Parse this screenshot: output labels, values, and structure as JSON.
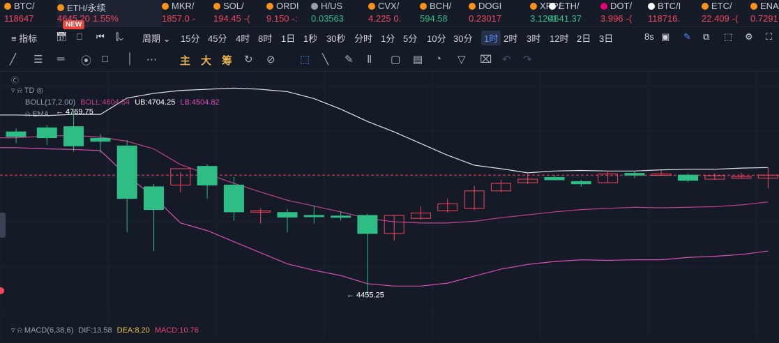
{
  "tickers": [
    {
      "symbol": "BTC/ ",
      "price": "118647",
      "change": "",
      "dir": "dn",
      "coin": "#f7931a"
    },
    {
      "symbol": "ETH/永续",
      "price": "4645.20",
      "change": "1.55%",
      "dir": "dn",
      "coin": "#f7931a",
      "selected": true
    },
    {
      "symbol": "MKR/",
      "price": "1857.0",
      "change": "-",
      "dir": "dn",
      "coin": "#f7931a"
    },
    {
      "symbol": "SOL/",
      "price": "194.45",
      "change": "-(",
      "dir": "dn",
      "coin": "#f7931a"
    },
    {
      "symbol": "ORDI",
      "price": "9.150",
      "change": "-:",
      "dir": "dn",
      "coin": "#f7931a"
    },
    {
      "symbol": "H/US",
      "price": "0.03563",
      "change": "",
      "dir": "up",
      "coin": "#9aa0ab"
    },
    {
      "symbol": "CVX/",
      "price": "4.225",
      "change": "0.",
      "dir": "dn",
      "coin": "#f7931a"
    },
    {
      "symbol": "BCH/",
      "price": "594.58",
      "change": "",
      "dir": "up",
      "coin": "#f7931a"
    },
    {
      "symbol": "DOGI",
      "price": "0.23017",
      "change": "",
      "dir": "dn",
      "coin": "#f7931a"
    },
    {
      "symbol": "XRP/",
      "price": "3.1201",
      "change": "",
      "dir": "up",
      "coin": "#f7931a"
    },
    {
      "symbol": "ETH/",
      "price": "4641.37",
      "change": "",
      "dir": "up",
      "coin": "#ffffff"
    },
    {
      "symbol": "DOT/",
      "price": "3.996",
      "change": "-(",
      "dir": "dn",
      "coin": "#e6007a"
    },
    {
      "symbol": "BTC/I",
      "price": "118716.",
      "change": "",
      "dir": "dn",
      "coin": "#ffffff"
    },
    {
      "symbol": "ETC/",
      "price": "22.409",
      "change": "-(",
      "dir": "dn",
      "coin": "#f7931a"
    },
    {
      "symbol": "ENA/",
      "price": "0.7291",
      "change": "",
      "dir": "dn",
      "coin": "#f7931a"
    }
  ],
  "new_badge": "NEW",
  "toolbar": {
    "indicator": "指标",
    "period": "周期",
    "intervals": [
      "15分",
      "45分",
      "4时",
      "8时",
      "1日",
      "1秒",
      "30秒",
      "分时",
      "1分",
      "5分",
      "10分",
      "30分",
      "1时",
      "2时",
      "3时",
      "12时",
      "2日",
      "3日"
    ],
    "active_interval": "1时",
    "refresh": "8s"
  },
  "drawbar": {
    "zhu": "主",
    "da": "大",
    "chou": "筹"
  },
  "legends": {
    "td": "TD",
    "boll_name": "BOLL(17,2.00)",
    "boll_val": "BOLL:4604.54",
    "ub": "UB:4704.25",
    "lb": "LB:4504.82",
    "ema": "EMA",
    "macd_name": "MACD(6,38,6)",
    "dif": "DIF:13.58",
    "dea": "DEA:8.20",
    "macd": "MACD:10.76"
  },
  "chart_data": {
    "type": "candlestick",
    "high_label": "4769.75",
    "low_label": "4455.25",
    "colors": {
      "up": "#2ebd85",
      "down": "#f6465d",
      "ub": "#dfe3ea",
      "lb": "#d94fb5",
      "mid": "#c2418f",
      "current": "#f6465d"
    },
    "candles": [
      {
        "o": 4734,
        "h": 4740,
        "l": 4715,
        "c": 4726
      },
      {
        "o": 4741,
        "h": 4746,
        "l": 4712,
        "c": 4724
      },
      {
        "o": 4743,
        "h": 4770,
        "l": 4700,
        "c": 4710
      },
      {
        "o": 4723,
        "h": 4731,
        "l": 4698,
        "c": 4718
      },
      {
        "o": 4710,
        "h": 4720,
        "l": 4562,
        "c": 4620
      },
      {
        "o": 4640,
        "h": 4645,
        "l": 4530,
        "c": 4601
      },
      {
        "o": 4643,
        "h": 4665,
        "l": 4630,
        "c": 4671
      },
      {
        "o": 4675,
        "h": 4679,
        "l": 4620,
        "c": 4643
      },
      {
        "o": 4643,
        "h": 4657,
        "l": 4582,
        "c": 4597
      },
      {
        "o": 4597,
        "h": 4603,
        "l": 4577,
        "c": 4599
      },
      {
        "o": 4596,
        "h": 4602,
        "l": 4562,
        "c": 4588
      },
      {
        "o": 4591,
        "h": 4608,
        "l": 4577,
        "c": 4590
      },
      {
        "o": 4590,
        "h": 4598,
        "l": 4582,
        "c": 4589
      },
      {
        "o": 4591,
        "h": 4594,
        "l": 4455,
        "c": 4560
      },
      {
        "o": 4560,
        "h": 4592,
        "l": 4548,
        "c": 4591
      },
      {
        "o": 4586,
        "h": 4606,
        "l": 4583,
        "c": 4595
      },
      {
        "o": 4599,
        "h": 4620,
        "l": 4596,
        "c": 4611
      },
      {
        "o": 4603,
        "h": 4642,
        "l": 4600,
        "c": 4633
      },
      {
        "o": 4633,
        "h": 4652,
        "l": 4631,
        "c": 4646
      },
      {
        "o": 4647,
        "h": 4664,
        "l": 4645,
        "c": 4653
      },
      {
        "o": 4656,
        "h": 4660,
        "l": 4651,
        "c": 4652
      },
      {
        "o": 4649,
        "h": 4652,
        "l": 4640,
        "c": 4645
      },
      {
        "o": 4647,
        "h": 4668,
        "l": 4647,
        "c": 4662
      },
      {
        "o": 4663,
        "h": 4667,
        "l": 4655,
        "c": 4660
      },
      {
        "o": 4662,
        "h": 4668,
        "l": 4659,
        "c": 4662
      },
      {
        "o": 4660,
        "h": 4663,
        "l": 4648,
        "c": 4651
      },
      {
        "o": 4653,
        "h": 4663,
        "l": 4652,
        "c": 4659
      },
      {
        "o": 4656,
        "h": 4664,
        "l": 4654,
        "c": 4657
      },
      {
        "o": 4655,
        "h": 4672,
        "l": 4637,
        "c": 4660
      }
    ]
  }
}
